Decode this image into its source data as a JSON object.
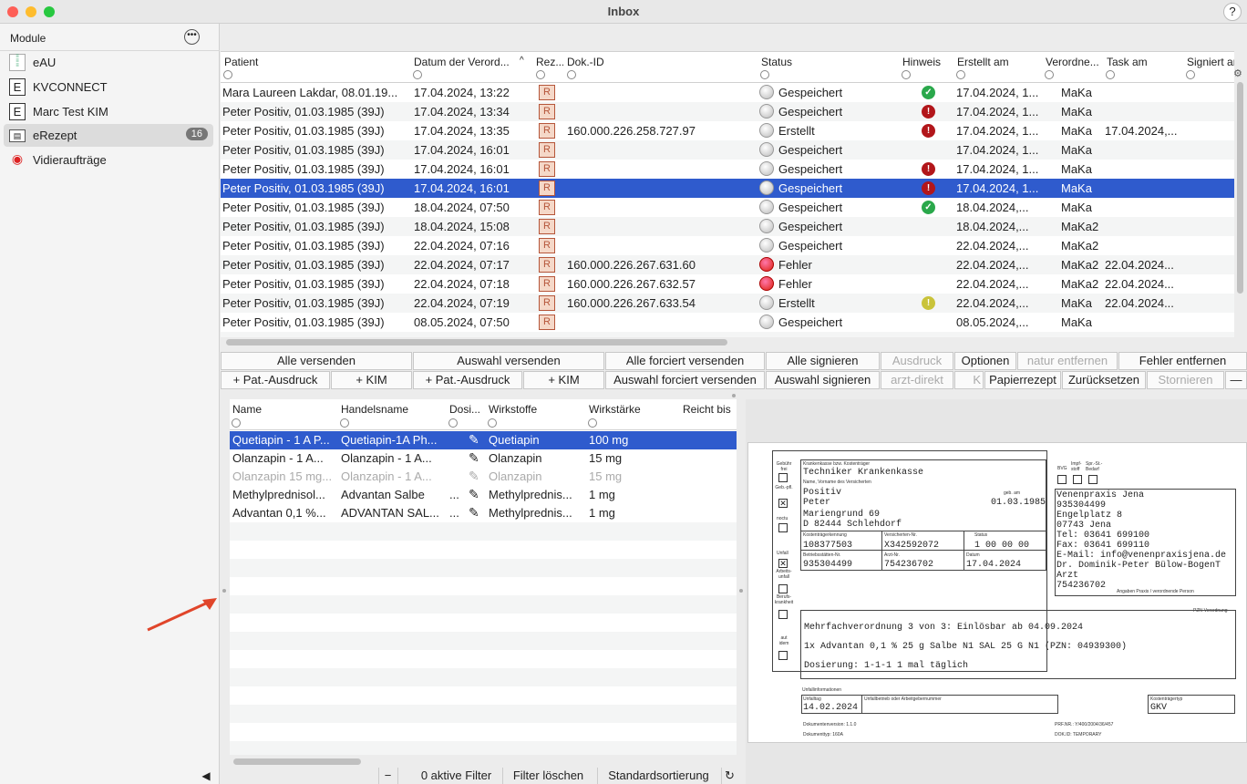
{
  "window": {
    "title": "Inbox",
    "help": "?"
  },
  "sidebar": {
    "header": "Module",
    "items": [
      {
        "label": "eAU",
        "icon": "document-icon",
        "selected": false
      },
      {
        "label": "KVCONNECT",
        "icon": "e-icon",
        "selected": false
      },
      {
        "label": "Marc Test KIM",
        "icon": "e-icon",
        "selected": false
      },
      {
        "label": "eRezept",
        "icon": "prescription-icon",
        "selected": true,
        "badge": "16"
      },
      {
        "label": "Vidieraufträge",
        "icon": "eye-icon",
        "selected": false
      }
    ]
  },
  "table": {
    "columns": [
      "Patient",
      "Datum der Verord...",
      "Rez...",
      "Dok.-ID",
      "Status",
      "Hinweis",
      "Erstellt am",
      "Verordne...",
      "Task am",
      "Signiert am"
    ],
    "rows": [
      {
        "patient": "Mara Laureen Lakdar, 08.01.19...",
        "datum": "17.04.2024, 13:22",
        "dok": "",
        "status": "Gespeichert",
        "hinweis": "ok",
        "erstellt": "17.04.2024, 1...",
        "verord": "MaKa",
        "task": ""
      },
      {
        "patient": "Peter Positiv, 01.03.1985 (39J)",
        "datum": "17.04.2024, 13:34",
        "dok": "",
        "status": "Gespeichert",
        "hinweis": "bad",
        "erstellt": "17.04.2024, 1...",
        "verord": "MaKa",
        "task": ""
      },
      {
        "patient": "Peter Positiv, 01.03.1985 (39J)",
        "datum": "17.04.2024, 13:35",
        "dok": "160.000.226.258.727.97",
        "status": "Erstellt",
        "hinweis": "bad",
        "erstellt": "17.04.2024, 1...",
        "verord": "MaKa",
        "task": "17.04.2024,..."
      },
      {
        "patient": "Peter Positiv, 01.03.1985 (39J)",
        "datum": "17.04.2024, 16:01",
        "dok": "",
        "status": "Gespeichert",
        "hinweis": "",
        "erstellt": "17.04.2024, 1...",
        "verord": "MaKa",
        "task": ""
      },
      {
        "patient": "Peter Positiv, 01.03.1985 (39J)",
        "datum": "17.04.2024, 16:01",
        "dok": "",
        "status": "Gespeichert",
        "hinweis": "bad",
        "erstellt": "17.04.2024, 1...",
        "verord": "MaKa",
        "task": ""
      },
      {
        "patient": "Peter Positiv, 01.03.1985 (39J)",
        "datum": "17.04.2024, 16:01",
        "dok": "",
        "status": "Gespeichert",
        "hinweis": "bad",
        "erstellt": "17.04.2024, 1...",
        "verord": "MaKa",
        "task": "",
        "selected": true
      },
      {
        "patient": "Peter Positiv, 01.03.1985 (39J)",
        "datum": "18.04.2024, 07:50",
        "dok": "",
        "status": "Gespeichert",
        "hinweis": "ok",
        "erstellt": "18.04.2024,...",
        "verord": "MaKa",
        "task": ""
      },
      {
        "patient": "Peter Positiv, 01.03.1985 (39J)",
        "datum": "18.04.2024, 15:08",
        "dok": "",
        "status": "Gespeichert",
        "hinweis": "",
        "erstellt": "18.04.2024,...",
        "verord": "MaKa2",
        "task": ""
      },
      {
        "patient": "Peter Positiv, 01.03.1985 (39J)",
        "datum": "22.04.2024, 07:16",
        "dok": "",
        "status": "Gespeichert",
        "hinweis": "",
        "erstellt": "22.04.2024,...",
        "verord": "MaKa2",
        "task": ""
      },
      {
        "patient": "Peter Positiv, 01.03.1985 (39J)",
        "datum": "22.04.2024, 07:17",
        "dok": "160.000.226.267.631.60",
        "status": "Fehler",
        "hinweis": "",
        "erstellt": "22.04.2024,...",
        "verord": "MaKa2",
        "task": "22.04.2024..."
      },
      {
        "patient": "Peter Positiv, 01.03.1985 (39J)",
        "datum": "22.04.2024, 07:18",
        "dok": "160.000.226.267.632.57",
        "status": "Fehler",
        "hinweis": "",
        "erstellt": "22.04.2024,...",
        "verord": "MaKa2",
        "task": "22.04.2024..."
      },
      {
        "patient": "Peter Positiv, 01.03.1985 (39J)",
        "datum": "22.04.2024, 07:19",
        "dok": "160.000.226.267.633.54",
        "status": "Erstellt",
        "hinweis": "warn",
        "erstellt": "22.04.2024,...",
        "verord": "MaKa",
        "task": "22.04.2024..."
      },
      {
        "patient": "Peter Positiv, 01.03.1985 (39J)",
        "datum": "08.05.2024, 07:50",
        "dok": "",
        "status": "Gespeichert",
        "hinweis": "",
        "erstellt": "08.05.2024,...",
        "verord": "MaKa",
        "task": ""
      }
    ]
  },
  "buttons_row1": [
    {
      "label": "Alle versenden",
      "enabled": true
    },
    {
      "label": "Auswahl versenden",
      "enabled": true
    },
    {
      "label": "Alle forciert versenden",
      "enabled": true
    },
    {
      "label": "Alle signieren",
      "enabled": true
    },
    {
      "label": "Ausdruck",
      "enabled": false
    },
    {
      "label": "Optionen",
      "enabled": true
    },
    {
      "label": "natur entfernen",
      "enabled": false
    },
    {
      "label": "Fehler entfernen",
      "enabled": true
    }
  ],
  "buttons_row2": [
    {
      "label": "+ Pat.-Ausdruck",
      "enabled": true
    },
    {
      "label": "+ KIM",
      "enabled": true
    },
    {
      "label": "+ Pat.-Ausdruck",
      "enabled": true
    },
    {
      "label": "+ KIM",
      "enabled": true
    },
    {
      "label": "Auswahl forciert versenden",
      "enabled": true
    },
    {
      "label": "Auswahl signieren",
      "enabled": true
    },
    {
      "label": "arzt-direkt",
      "enabled": false
    },
    {
      "label": "K",
      "enabled": false
    },
    {
      "label": "Papierrezept",
      "enabled": true
    },
    {
      "label": "Zurücksetzen",
      "enabled": true
    },
    {
      "label": "Stornieren",
      "enabled": false
    },
    {
      "label": "—",
      "enabled": true
    }
  ],
  "meds": {
    "columns": [
      "Name",
      "Handelsname",
      "Dosi...",
      "Wirkstoffe",
      "Wirkstärke",
      "Reicht bis"
    ],
    "rows": [
      {
        "name": "Quetiapin - 1 A P...",
        "handel": "Quetiapin-1A Ph...",
        "dosi": "",
        "wirk": "Quetiapin",
        "staerke": "100 mg",
        "state": "selected"
      },
      {
        "name": "Olanzapin - 1 A...",
        "handel": "Olanzapin - 1 A...",
        "dosi": "",
        "wirk": "Olanzapin",
        "staerke": "15 mg",
        "state": "normal"
      },
      {
        "name": "Olanzapin 15 mg...",
        "handel": "Olanzapin - 1 A...",
        "dosi": "",
        "wirk": "Olanzapin",
        "staerke": "15 mg",
        "state": "dim"
      },
      {
        "name": "Methylprednisol...",
        "handel": "Advantan Salbe",
        "dosi": "...",
        "wirk": "Methylprednis...",
        "staerke": "1 mg",
        "state": "normal"
      },
      {
        "name": "Advantan 0,1 %...",
        "handel": "ADVANTAN SAL...",
        "dosi": "...",
        "wirk": "Methylprednis...",
        "staerke": "1 mg",
        "state": "normal"
      }
    ]
  },
  "bottom_bar": {
    "minus": "−",
    "filters": "0 aktive Filter",
    "clear": "Filter löschen",
    "sort": "Standardsortierung",
    "refresh": "↻"
  },
  "form": {
    "labels": {
      "gebuehr": "Gebühr frei",
      "gebpfl": "Geb.-pfl.",
      "noctu": "noctu",
      "unfall": "Unfall",
      "arbeit": "Arbeits-unfall",
      "beruf": "Berufs-krankheit",
      "autidem": "aut idem",
      "kasse": "Krankenkasse bzw. Kostenträger",
      "name": "Name, Vorname des Versicherten",
      "gebam": "geb. am",
      "ktk": "Kostenträgerkennung",
      "vnr": "Versicherten-Nr.",
      "status": "Status",
      "bsnr": "Betriebsstätten-Nr.",
      "arztnr": "Arzt-Nr.",
      "datum": "Datum",
      "bvg": "BVG",
      "impf": "Impf-stoff",
      "spr": "Spr.-St.-Bedarf",
      "praxis": "Angaben Praxis / verordnende Person",
      "pzn": "PZN-Verordnung",
      "unfallinfo": "Unfallinformationen",
      "unfalltag": "Unfalltag",
      "unfallbetrieb": "Unfallbetrieb oder Arbeitgebernummer",
      "kttyp": "Kostenträgertyp",
      "docver": "Dokumentenversion: 1.1.0",
      "doctyp": "Dokumenttyp: 160A",
      "prfnr": "PRF.NR.: Y/400/2004/36/457",
      "docid": "DOK.ID: TEMPORARY"
    },
    "kasse": "Techniker Krankenkasse",
    "nachname": "Positiv",
    "vorname": "Peter",
    "strasse": "Mariengrund 69",
    "ort": "D 82444 Schlehdorf",
    "geb": "01.03.1985",
    "ktk": "108377503",
    "vnr": "X342592072",
    "status": "1 00 00 00",
    "bsnr": "935304499",
    "arztnr": "754236702",
    "datum": "17.04.2024",
    "praxis": [
      "Venenpraxis Jena",
      "935304499",
      "Engelplatz 8",
      "07743 Jena",
      "Tel: 03641 699100",
      "Fax: 03641 699110",
      "E-Mail: info@venenpraxisjena.de",
      "Dr. Dominik-Peter Bülow-BogenT",
      "Arzt",
      "754236702"
    ],
    "verordnung": [
      "Mehrfachverordnung 3 von 3: Einlösbar ab 04.09.2024",
      "1x Advantan 0,1 % 25 g Salbe N1 SAL 25 G N1 (PZN: 04939300)",
      "Dosierung: 1-1-1 1 mal täglich"
    ],
    "unfalltag": "14.02.2024",
    "kttyp": "GKV"
  },
  "colors": {
    "selection": "#2f5bcd",
    "error": "#d21",
    "ok": "#2aa84b",
    "arrow": "#e0452a"
  }
}
